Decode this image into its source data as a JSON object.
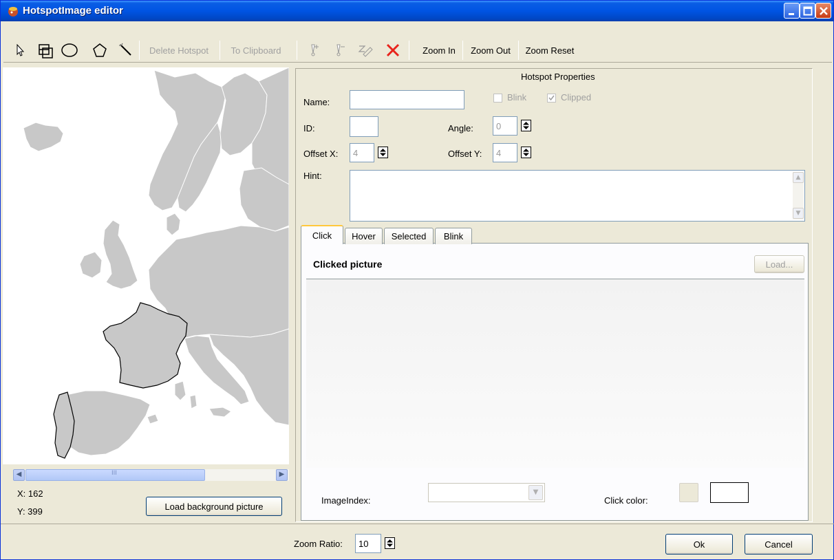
{
  "window": {
    "title": "HotspotImage editor",
    "colors": {
      "titlebar": "#0054e3",
      "face": "#ece9d8",
      "close": "#c63b14",
      "map_fill": "#c8c8c8",
      "map_selected": "#c8c8c8"
    }
  },
  "toolbar": {
    "delete_hotspot": "Delete Hotspot",
    "to_clipboard": "To Clipboard",
    "zoom_in": "Zoom In",
    "zoom_out": "Zoom Out",
    "zoom_reset": "Zoom Reset"
  },
  "map": {
    "coord_x": "X: 162",
    "coord_y": "Y: 399",
    "load_background": "Load background picture",
    "scroll_grip": "III"
  },
  "properties": {
    "header": "Hotspot Properties",
    "name_label": "Name:",
    "name_value": "",
    "blink_label": "Blink",
    "clipped_label": "Clipped",
    "blink_checked": false,
    "clipped_checked": true,
    "id_label": "ID:",
    "id_value": "",
    "angle_label": "Angle:",
    "angle_value": "0",
    "offset_x_label": "Offset X:",
    "offset_x_value": "4",
    "offset_y_label": "Offset Y:",
    "offset_y_value": "4",
    "hint_label": "Hint:",
    "hint_value": ""
  },
  "tabs": {
    "items": [
      "Click",
      "Hover",
      "Selected",
      "Blink"
    ],
    "active": "Click"
  },
  "click_tab": {
    "title": "Clicked picture",
    "load_label": "Load...",
    "image_index_label": "ImageIndex:",
    "image_index_value": "",
    "click_color_label": "Click color:"
  },
  "footer": {
    "zoom_ratio_label": "Zoom Ratio:",
    "zoom_ratio_value": "10",
    "ok_label": "Ok",
    "cancel_label": "Cancel"
  }
}
